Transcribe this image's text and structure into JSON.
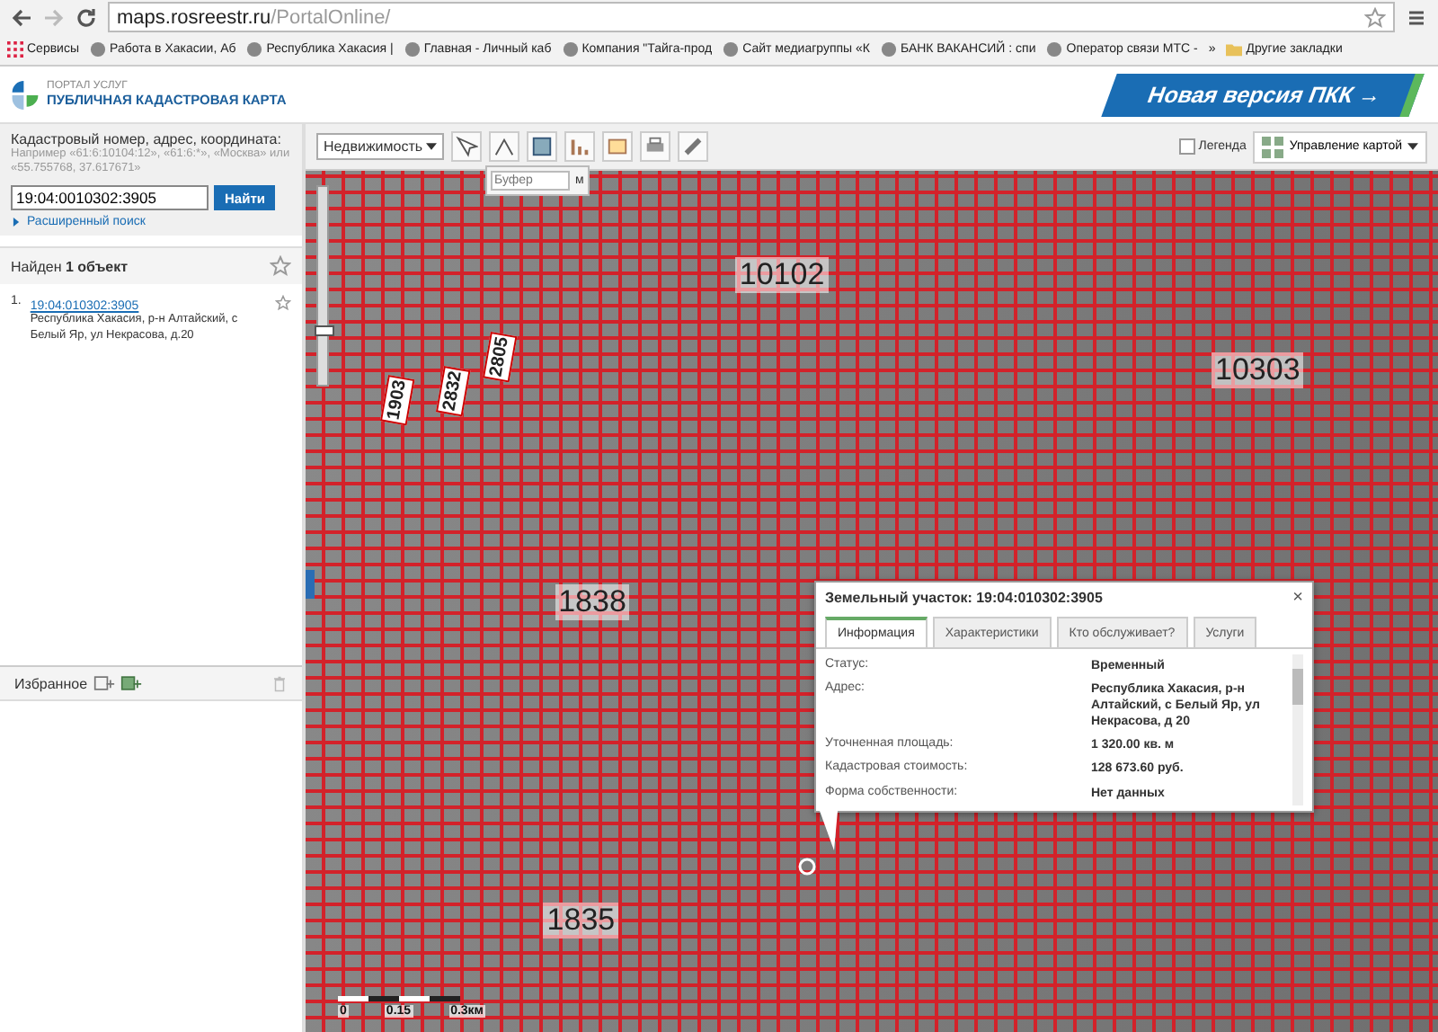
{
  "browser": {
    "url_host": "maps.rosreestr.ru",
    "url_path": "/PortalOnline/",
    "bookmarks": [
      {
        "label": "Сервисы",
        "kind": "apps"
      },
      {
        "label": "Работа в Хакасии, Аб",
        "kind": "page"
      },
      {
        "label": "Республика Хакасия |",
        "kind": "page"
      },
      {
        "label": "Главная - Личный каб",
        "kind": "page"
      },
      {
        "label": "Компания \"Тайга-прод",
        "kind": "page"
      },
      {
        "label": "Сайт медиагруппы «К",
        "kind": "page"
      },
      {
        "label": "БАНК ВАКАНСИЙ : спи",
        "kind": "page"
      },
      {
        "label": "Оператор связи МТС -",
        "kind": "page"
      },
      {
        "label": "»",
        "kind": "more"
      },
      {
        "label": "Другие закладки",
        "kind": "folder"
      }
    ]
  },
  "header": {
    "portal": "ПОРТАЛ УСЛУГ",
    "title": "ПУБЛИЧНАЯ КАДАСТРОВАЯ КАРТА",
    "banner": "Новая версия ПКК →"
  },
  "search": {
    "label": "Кадастровый номер, адрес, координата:",
    "hint": "Например «61:6:10104:12», «61:6:*», «Москва» или «55.755768, 37.617671»",
    "value": "19:04:0010302:3905",
    "button": "Найти",
    "advanced": "Расширенный поиск"
  },
  "results": {
    "heading": "Найден **1 объект**",
    "items": [
      {
        "number": "1.",
        "link": "19:04:010302:3905",
        "address": "Республика Хакасия, р-н Алтайский, с Белый Яр, ул Некрасова, д.20"
      }
    ]
  },
  "favorites": {
    "label": "Избранное"
  },
  "toolbar": {
    "dropdown": "Недвижимость",
    "buffer_placeholder": "Буфер",
    "buffer_unit": "м",
    "legend": {
      "label": "Легенда",
      "checked": false
    },
    "map_control": "Управление картой"
  },
  "map": {
    "zoom": {
      "level": 0.3
    },
    "labels": [
      {
        "text": "10102",
        "kind": "plain"
      },
      {
        "text": "10303",
        "kind": "plain"
      },
      {
        "text": "1838",
        "kind": "plain"
      },
      {
        "text": "1835",
        "kind": "plain"
      },
      {
        "text": "1903",
        "kind": "boxed"
      },
      {
        "text": "2832",
        "kind": "boxed"
      },
      {
        "text": "2805",
        "kind": "boxed"
      }
    ],
    "scale": [
      "0",
      "0.15",
      "0.3км"
    ]
  },
  "popup": {
    "title": "Земельный участок: 19:04:010302:3905",
    "close": "×",
    "tabs": [
      {
        "label": "Информация",
        "selected": true
      },
      {
        "label": "Характеристики",
        "selected": false
      },
      {
        "label": "Кто обслуживает?",
        "selected": false
      },
      {
        "label": "Услуги",
        "selected": false
      }
    ],
    "rows": [
      {
        "label": "Статус:",
        "value": "Временный"
      },
      {
        "label": "Адрес:",
        "value": "Республика Хакасия, р-н Алтайский, с Белый Яр, ул Некрасова, д 20"
      },
      {
        "label": "Уточненная площадь:",
        "value": "1 320.00 кв. м"
      },
      {
        "label": "Кадастровая стоимость:",
        "value": "128 673.60 руб."
      },
      {
        "label": "Форма собственности:",
        "value": "Нет данных"
      }
    ]
  }
}
